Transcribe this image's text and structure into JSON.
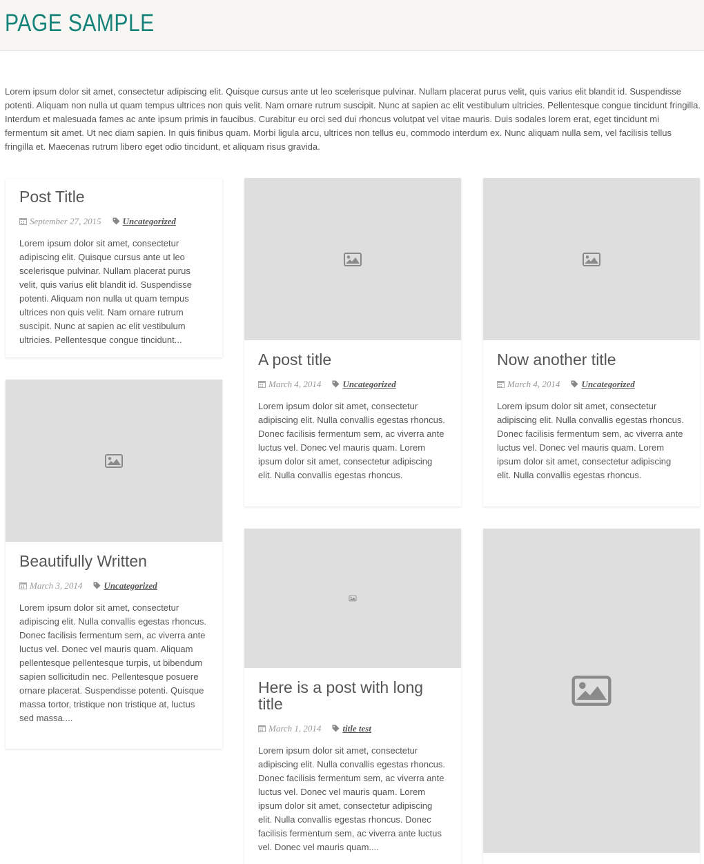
{
  "header": {
    "title": "PAGE SAMPLE"
  },
  "intro": "Lorem ipsum dolor sit amet, consectetur adipiscing elit. Quisque cursus ante ut leo scelerisque pulvinar. Nullam placerat purus velit, quis varius elit blandit id. Suspendisse potenti. Aliquam non nulla ut quam tempus ultrices non quis velit. Nam ornare rutrum suscipit. Nunc at sapien ac elit vestibulum ultricies. Pellentesque congue tincidunt fringilla. Interdum et malesuada fames ac ante ipsum primis in faucibus. Curabitur eu orci sed dui rhoncus volutpat vel vitae mauris. Duis sodales lorem erat, eget tincidunt mi fermentum sit amet. Ut nec diam sapien. In quis finibus quam. Morbi ligula arcu, ultrices non tellus eu, commodo interdum ex. Nunc aliquam nulla sem, vel facilisis tellus fringilla et. Maecenas rutrum libero eget odio tincidunt, et aliquam risus gravida.",
  "posts": [
    {
      "title": "Post Title",
      "date": "September 27, 2015",
      "category": "Uncategorized",
      "excerpt": "Lorem ipsum dolor sit amet, consectetur adipiscing elit. Quisque cursus ante ut leo scelerisque pulvinar. Nullam placerat purus velit, quis varius elit blandit id. Suspendisse potenti. Aliquam non nulla ut quam tempus ultrices non quis velit. Nam ornare rutrum suscipit. Nunc at sapien ac elit vestibulum ultricies. Pellentesque congue tincidunt..."
    },
    {
      "title": "A post title",
      "date": "March 4, 2014",
      "category": "Uncategorized",
      "excerpt": "Lorem ipsum dolor sit amet, consectetur adipiscing elit. Nulla convallis egestas rhoncus. Donec facilisis fermentum sem, ac viverra ante luctus vel. Donec vel mauris quam. Lorem ipsum dolor sit amet, consectetur adipiscing elit. Nulla convallis egestas rhoncus."
    },
    {
      "title": "Now another title",
      "date": "March 4, 2014",
      "category": "Uncategorized",
      "excerpt": "Lorem ipsum dolor sit amet, consectetur adipiscing elit. Nulla convallis egestas rhoncus. Donec facilisis fermentum sem, ac viverra ante luctus vel. Donec vel mauris quam. Lorem ipsum dolor sit amet, consectetur adipiscing elit. Nulla convallis egestas rhoncus."
    },
    {
      "title": "Beautifully Written",
      "date": "March 3, 2014",
      "category": "Uncategorized",
      "excerpt": "Lorem ipsum dolor sit amet, consectetur adipiscing elit. Nulla convallis egestas rhoncus. Donec facilisis fermentum sem, ac viverra ante luctus vel. Donec vel mauris quam. Aliquam pellentesque pellentesque turpis, ut bibendum sapien sollicitudin nec. Pellentesque posuere ornare placerat. Suspendisse potenti. Quisque massa tortor, tristique non tristique at, luctus sed massa...."
    },
    {
      "title": "Here is a post with long title",
      "date": "March 1, 2014",
      "category": "title test",
      "excerpt": "Lorem ipsum dolor sit amet, consectetur adipiscing elit. Nulla convallis egestas rhoncus. Donec facilisis fermentum sem, ac viverra ante luctus vel. Donec vel mauris quam. Lorem ipsum dolor sit amet, consectetur adipiscing elit. Nulla convallis egestas rhoncus. Donec facilisis fermentum sem, ac viverra ante luctus vel. Donec vel mauris quam...."
    }
  ],
  "icons": {
    "date": "calendar-icon",
    "category": "tag-icon",
    "thumbnail": "image-placeholder-icon"
  },
  "colors": {
    "title": "#16837a",
    "header_bg": "#f7f6f3",
    "thumbnail_bg": "#dedede"
  }
}
